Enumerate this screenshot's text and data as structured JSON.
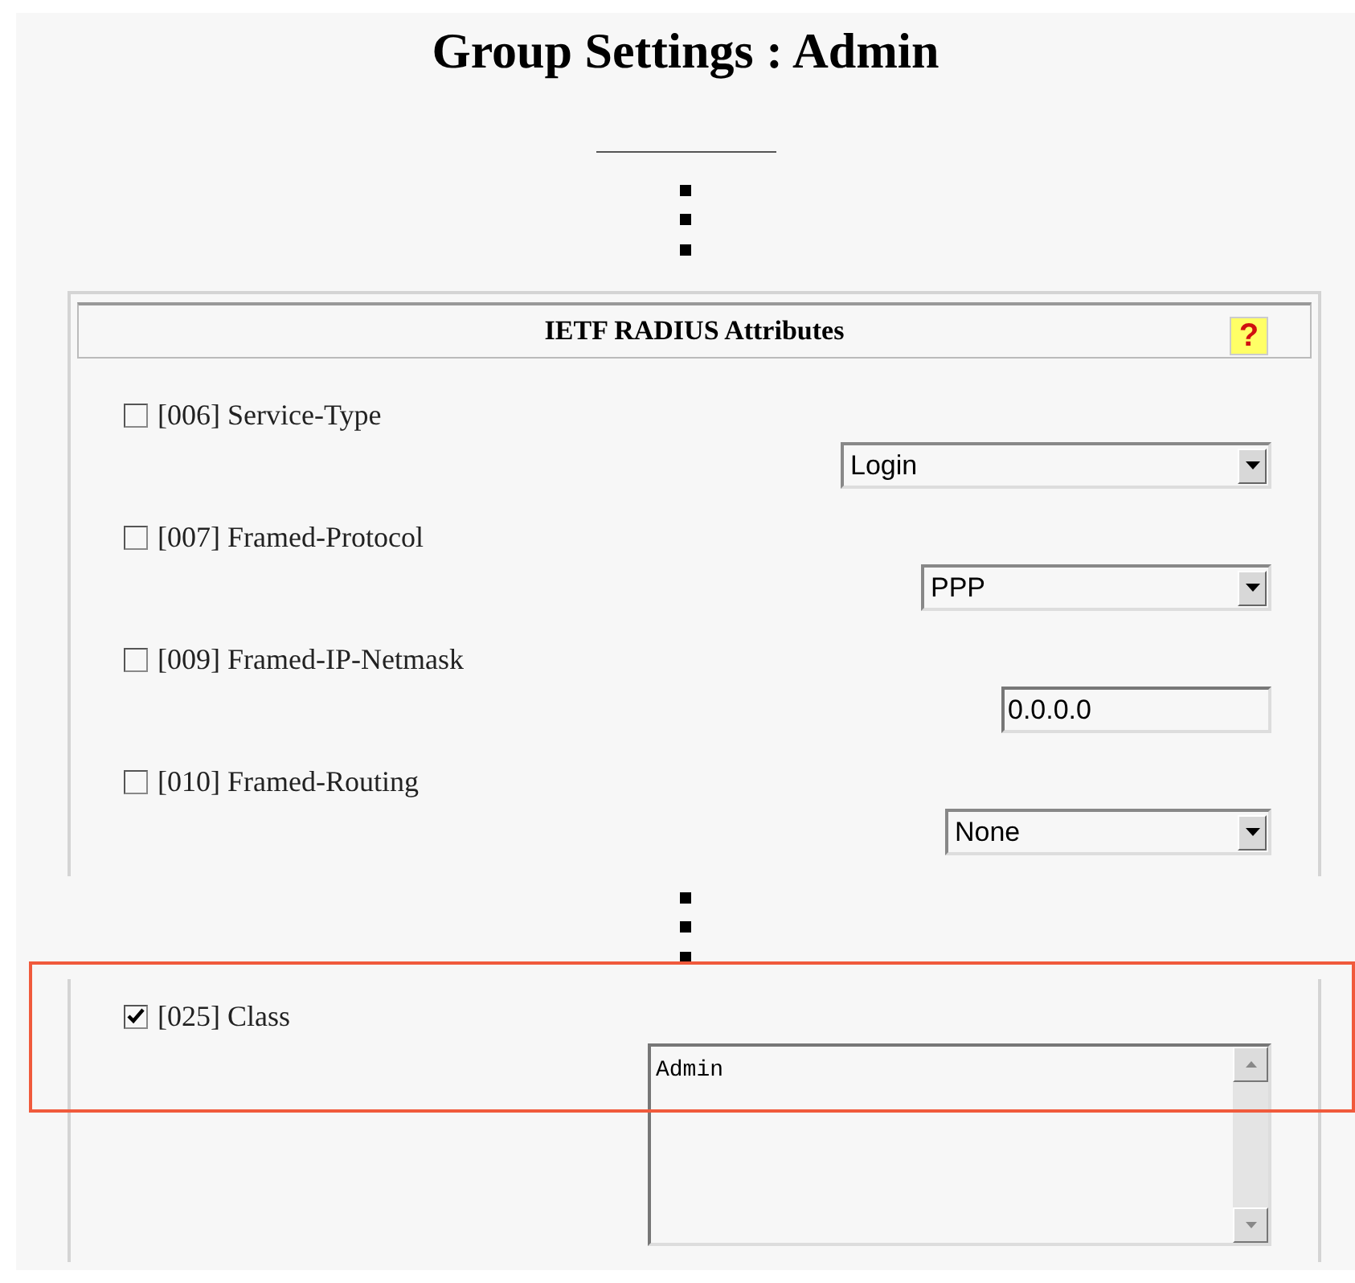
{
  "page_title": "Group Settings : Admin",
  "panel": {
    "title": "IETF RADIUS Attributes",
    "help": "?",
    "attributes": [
      {
        "kind": "select",
        "label": "[006] Service-Type",
        "checked": false,
        "value": "Login"
      },
      {
        "kind": "select",
        "label": "[007] Framed-Protocol",
        "checked": false,
        "value": "PPP"
      },
      {
        "kind": "text",
        "label": "[009] Framed-IP-Netmask",
        "checked": false,
        "value": "0.0.0.0"
      },
      {
        "kind": "select",
        "label": "[010] Framed-Routing",
        "checked": false,
        "value": "None"
      }
    ]
  },
  "panel_continued": {
    "attributes": [
      {
        "kind": "textarea",
        "label": "[025] Class",
        "checked": true,
        "value": "Admin"
      }
    ]
  }
}
